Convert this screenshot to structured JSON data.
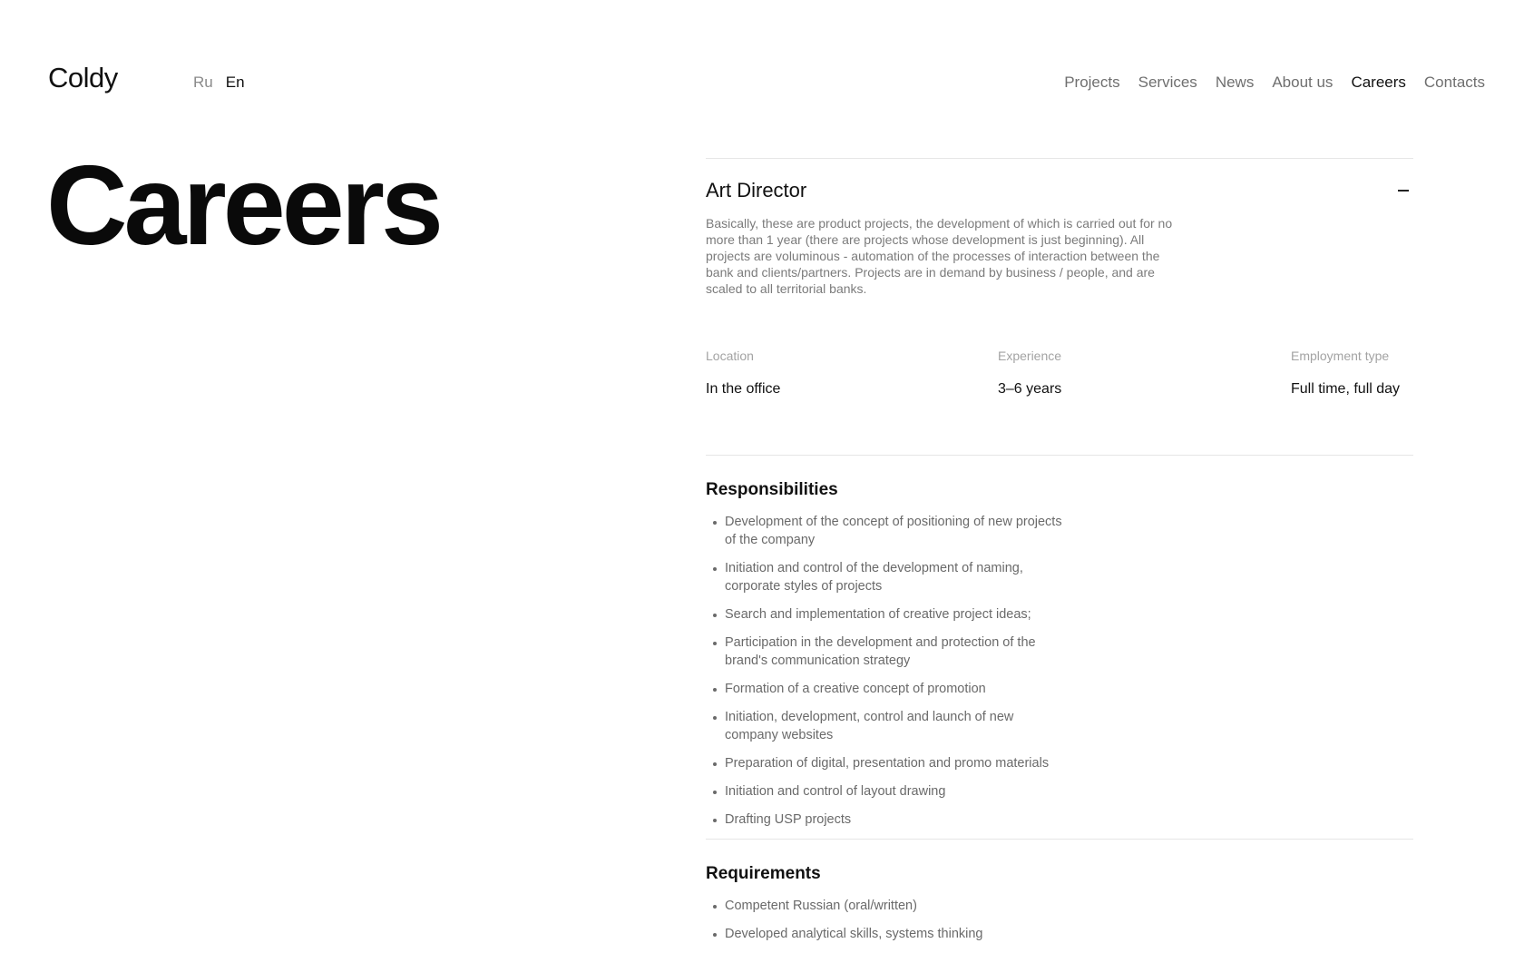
{
  "header": {
    "logo": "Coldy",
    "languages": [
      {
        "label": "Ru",
        "active": false
      },
      {
        "label": "En",
        "active": true
      }
    ],
    "nav": [
      {
        "label": "Projects",
        "active": false
      },
      {
        "label": "Services",
        "active": false
      },
      {
        "label": "News",
        "active": false
      },
      {
        "label": "About us",
        "active": false
      },
      {
        "label": "Careers",
        "active": true
      },
      {
        "label": "Contacts",
        "active": false
      }
    ]
  },
  "hero": {
    "title": "Careers"
  },
  "job": {
    "title": "Art Director",
    "toggle_icon": "minus-icon",
    "description": "Basically, these are product projects, the development of which is carried out for no more than 1 year (there are projects whose development is just beginning). All projects are voluminous - automation of the processes of interaction between the bank and clients/partners. Projects are in demand by business / people, and are scaled to all territorial banks.",
    "meta": [
      {
        "label": "Location",
        "value": "In the office"
      },
      {
        "label": "Experience",
        "value": "3–6 years"
      },
      {
        "label": "Employment type",
        "value": "Full time, full day"
      }
    ],
    "responsibilities": {
      "title": "Responsibilities",
      "items": [
        "Development of the concept of positioning of new projects of the company",
        "Initiation and control of the development of naming, corporate styles of projects",
        "Search and implementation of creative project ideas;",
        "Participation in the development and protection of the brand's communication strategy",
        "Formation of a creative concept of promotion",
        "Initiation, development, control and launch of new company websites",
        "Preparation of digital, presentation and promo materials",
        "Initiation and control of layout drawing",
        "Drafting USP projects"
      ]
    },
    "requirements": {
      "title": "Requirements",
      "items": [
        "Competent Russian (oral/written)",
        "Developed analytical skills, systems thinking"
      ]
    }
  }
}
